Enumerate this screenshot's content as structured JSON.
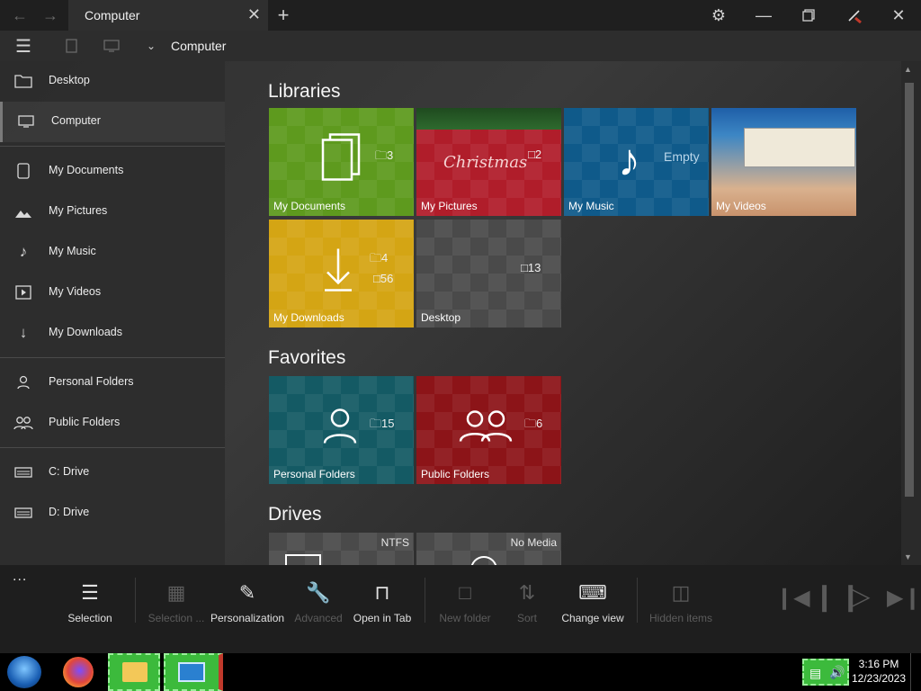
{
  "titlebar": {
    "tab_title": "Computer",
    "icons": [
      "back-arrow-icon",
      "forward-arrow-icon",
      "close-icon",
      "plus-icon",
      "gear-icon",
      "minimize-icon",
      "restore-icon",
      "pen-icon",
      "window-close-icon"
    ]
  },
  "addressbar": {
    "path": "Computer"
  },
  "sidebar": {
    "items": [
      {
        "label": "Desktop",
        "icon": "folder-icon"
      },
      {
        "label": "Computer",
        "icon": "monitor-icon"
      },
      {
        "label": "My Documents",
        "icon": "document-icon"
      },
      {
        "label": "My Pictures",
        "icon": "picture-icon"
      },
      {
        "label": "My Music",
        "icon": "music-note-icon"
      },
      {
        "label": "My Videos",
        "icon": "video-icon"
      },
      {
        "label": "My Downloads",
        "icon": "download-icon"
      },
      {
        "label": "Personal Folders",
        "icon": "person-icon"
      },
      {
        "label": "Public Folders",
        "icon": "people-icon"
      },
      {
        "label": "C:  Drive",
        "icon": "drive-icon"
      },
      {
        "label": "D:  Drive",
        "icon": "drive-icon"
      }
    ]
  },
  "sections": {
    "libraries": "Libraries",
    "favorites": "Favorites",
    "drives": "Drives"
  },
  "tiles": {
    "libraries": [
      {
        "label": "My Documents",
        "count": "3",
        "color": "#5e9a1e"
      },
      {
        "label": "My Pictures",
        "count": "2",
        "color": "#b01d2a",
        "art": "Christmas"
      },
      {
        "label": "My Music",
        "count": "Empty",
        "color": "#0f5a8a"
      },
      {
        "label": "My Videos",
        "count": "",
        "color": "#2a7ab8"
      },
      {
        "label": "My Downloads",
        "folder_count": "4",
        "file_count": "56",
        "color": "#d4a514"
      },
      {
        "label": "Desktop",
        "count": "13",
        "color": "#4a4a4a"
      }
    ],
    "favorites": [
      {
        "label": "Personal Folders",
        "count": "15",
        "color": "#145a64"
      },
      {
        "label": "Public Folders",
        "count": "6",
        "color": "#8c1418"
      }
    ],
    "drives": [
      {
        "badge": "NTFS",
        "color": "#4a4a4a"
      },
      {
        "badge": "No Media",
        "color": "#4a4a4a"
      }
    ]
  },
  "commandbar": {
    "items": [
      {
        "label": "Selection",
        "icon": "checklist-icon",
        "enabled": true
      },
      {
        "label": "Selection ...",
        "icon": "grid-select-icon",
        "enabled": false
      },
      {
        "label": "Personalization",
        "icon": "paint-icon",
        "enabled": true
      },
      {
        "label": "Advanced",
        "icon": "wrench-icon",
        "enabled": false
      },
      {
        "label": "Open in Tab",
        "icon": "tab-plus-icon",
        "enabled": true
      },
      {
        "label": "New folder",
        "icon": "new-folder-icon",
        "enabled": false
      },
      {
        "label": "Sort",
        "icon": "sort-icon",
        "enabled": false
      },
      {
        "label": "Change view",
        "icon": "keyboard-icon",
        "enabled": true
      },
      {
        "label": "Hidden items",
        "icon": "hidden-items-icon",
        "enabled": false
      }
    ],
    "more": "..."
  },
  "taskbar": {
    "time": "3:16 PM",
    "date": "12/23/2023"
  }
}
